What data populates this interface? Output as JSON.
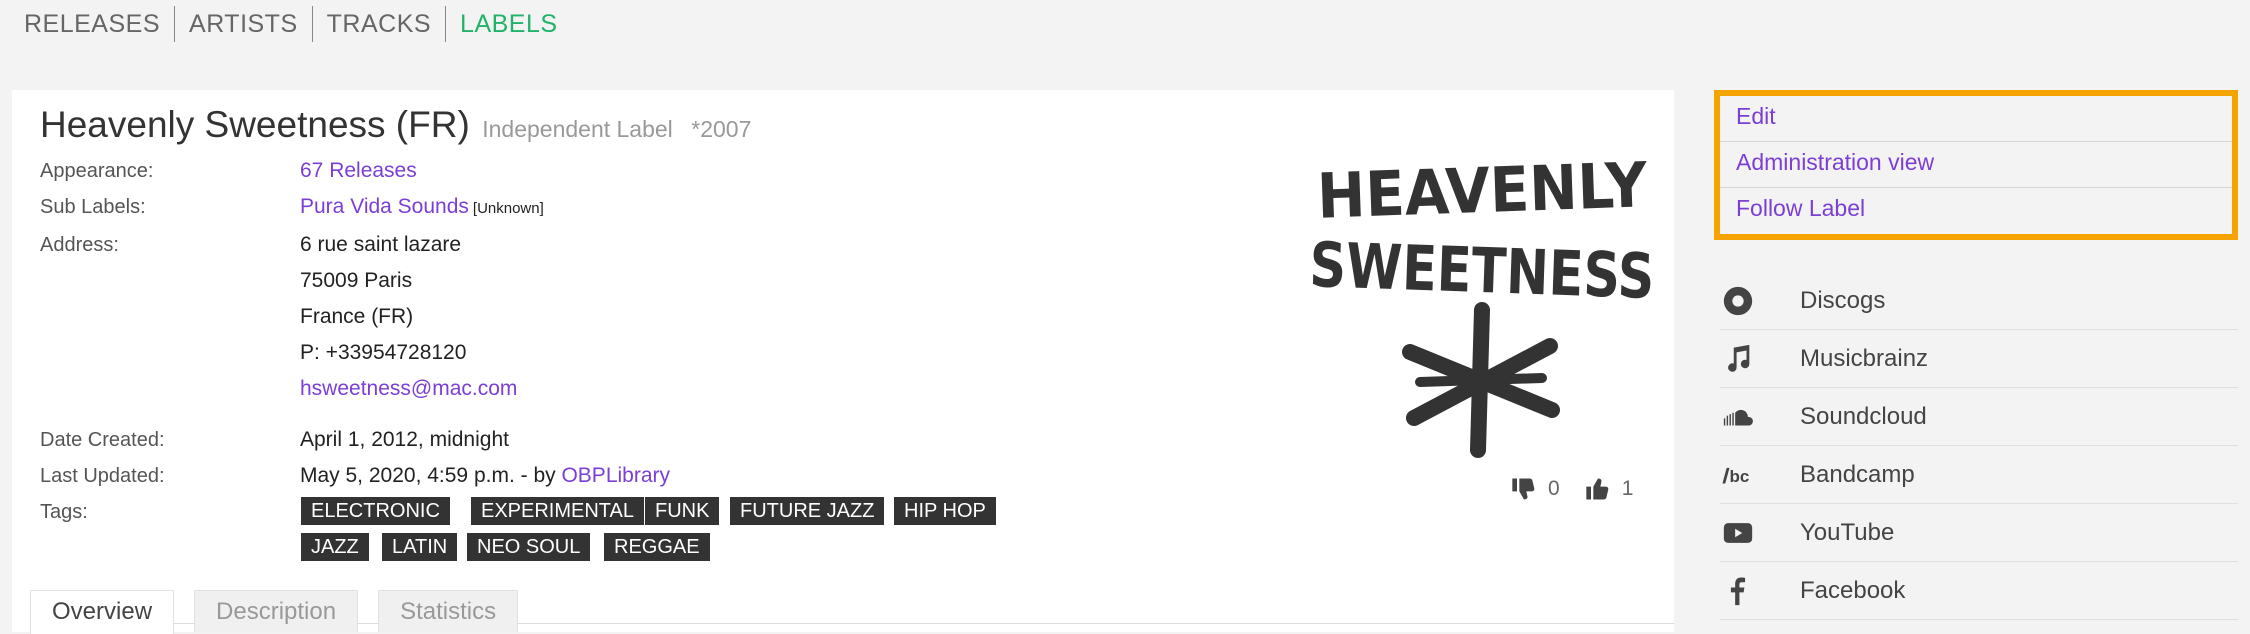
{
  "nav": {
    "items": [
      {
        "label": "RELEASES"
      },
      {
        "label": "ARTISTS"
      },
      {
        "label": "TRACKS"
      },
      {
        "label": "LABELS",
        "active": true
      }
    ],
    "active_color": "#22b36a"
  },
  "label": {
    "name": "Heavenly Sweetness (FR)",
    "type": "Independent Label",
    "founded": "*2007",
    "fields": {
      "appearance_label": "Appearance:",
      "appearance_value": "67 Releases",
      "sublabels_label": "Sub Labels:",
      "sublabel_name": "Pura Vida Sounds",
      "sublabel_note": "[Unknown]",
      "address_label": "Address:",
      "address_line1": "6 rue saint lazare",
      "address_line2": "75009 Paris",
      "address_line3": "France (FR)",
      "phone": "P: +33954728120",
      "email": "hsweetness@mac.com",
      "date_created_label": "Date Created:",
      "date_created_value": "April 1, 2012, midnight",
      "last_updated_label": "Last Updated:",
      "last_updated_value": "May 5, 2020, 4:59 p.m. - by ",
      "last_updated_user": "OBPLibrary",
      "tags_label": "Tags:"
    },
    "tags": [
      "ELECTRONIC",
      "EXPERIMENTAL",
      "FUNK",
      "FUTURE JAZZ",
      "HIP HOP",
      "JAZZ",
      "LATIN",
      "NEO SOUL",
      "REGGAE"
    ],
    "logo_text_line1": "HEAVENLY",
    "logo_text_line2": "SWEETNESS",
    "votes": {
      "down": "0",
      "up": "1"
    }
  },
  "tabs": [
    {
      "label": "Overview",
      "active": true
    },
    {
      "label": "Description"
    },
    {
      "label": "Statistics"
    }
  ],
  "sidebar": {
    "actions": [
      {
        "label": "Edit"
      },
      {
        "label": "Administration view"
      },
      {
        "label": "Follow Label"
      }
    ],
    "highlight_color": "#f5a300",
    "links": [
      {
        "name": "Discogs",
        "icon": "discogs-icon"
      },
      {
        "name": "Musicbrainz",
        "icon": "music-note-icon"
      },
      {
        "name": "Soundcloud",
        "icon": "soundcloud-icon"
      },
      {
        "name": "Bandcamp",
        "icon": "bandcamp-icon"
      },
      {
        "name": "YouTube",
        "icon": "youtube-icon"
      },
      {
        "name": "Facebook",
        "icon": "facebook-icon"
      }
    ]
  },
  "colors": {
    "link": "#7b3fd6",
    "tag_bg": "#333333"
  }
}
